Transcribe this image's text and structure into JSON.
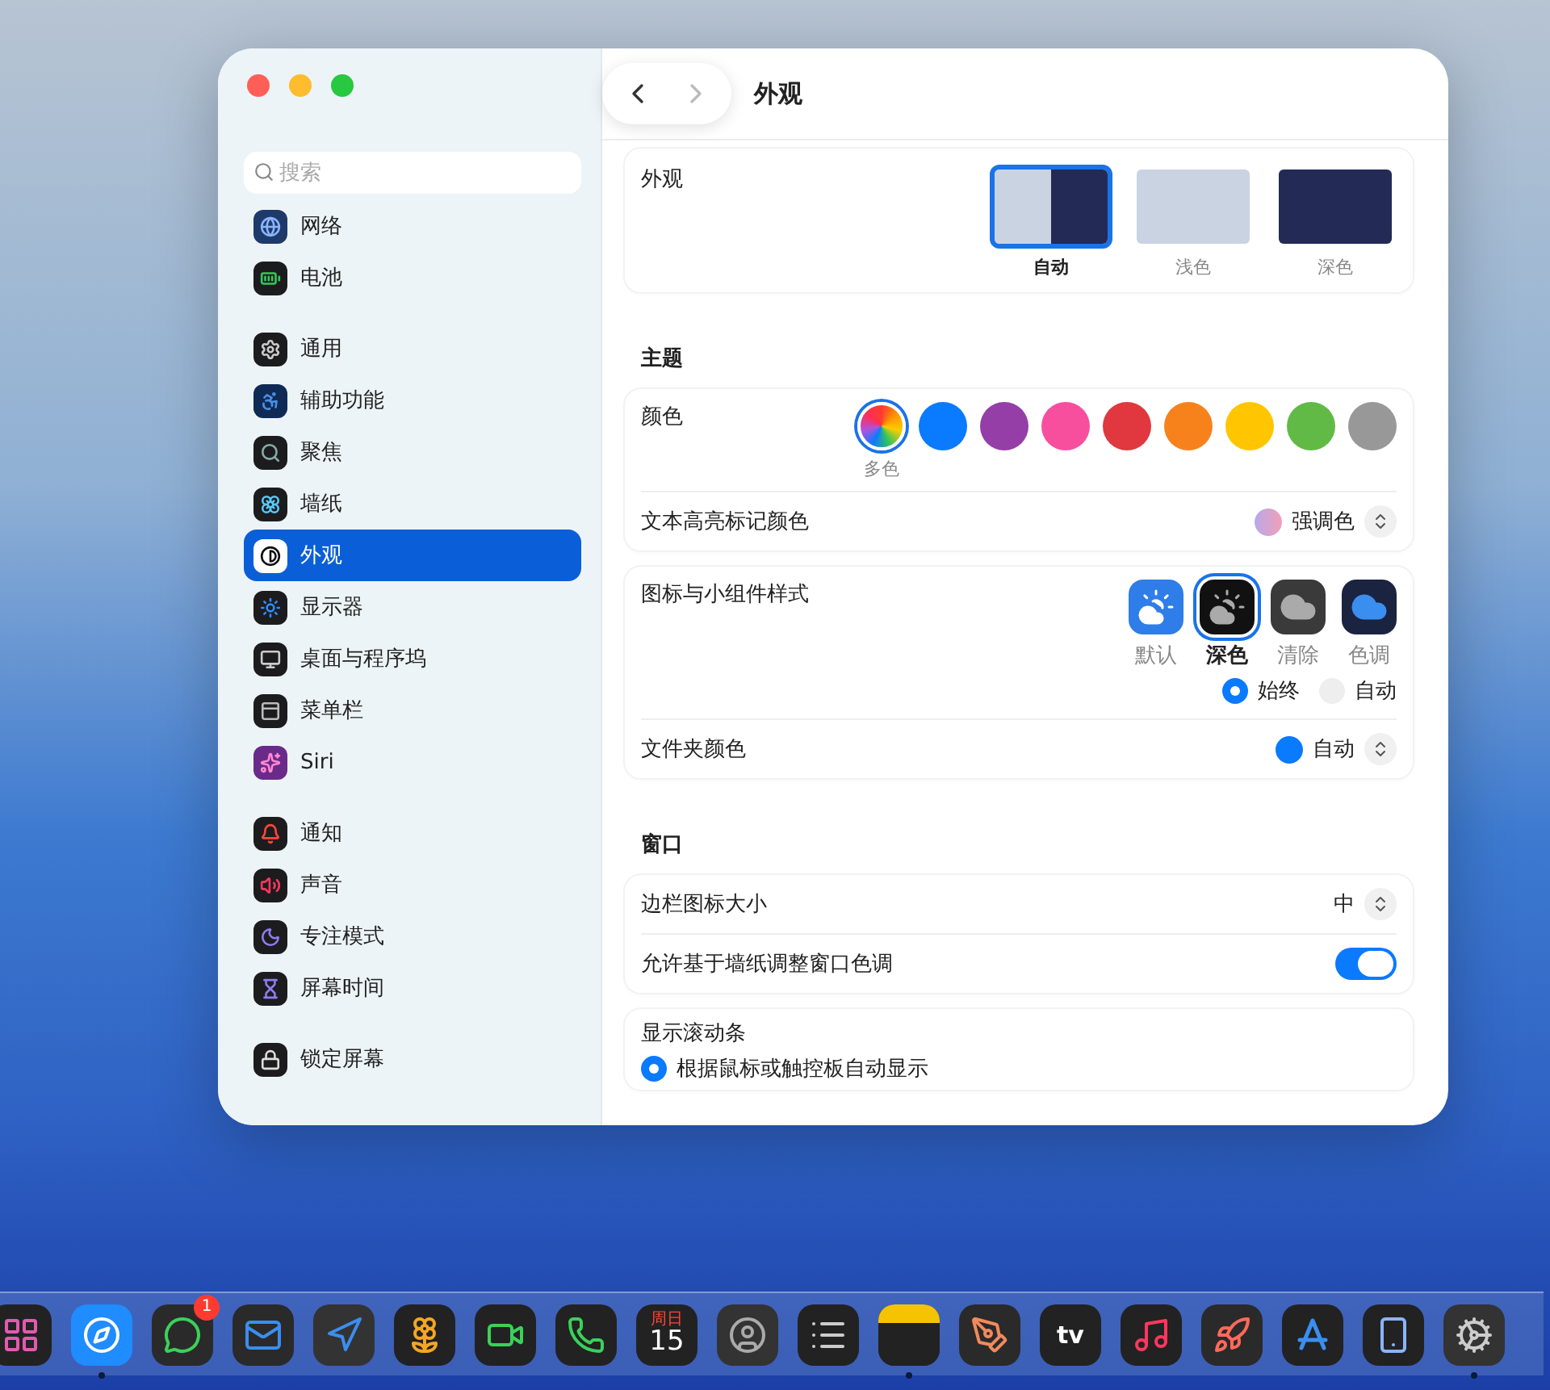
{
  "toolbar": {
    "nav": [
      {
        "kind": "back",
        "disabled": false
      },
      {
        "kind": "forward",
        "disabled": true
      }
    ],
    "title": "外观"
  },
  "sidebar": {
    "search": {
      "placeholder": "搜索"
    },
    "groups": [
      {
        "items": [
          {
            "label": "网络",
            "selected": false
          },
          {
            "label": "电池",
            "selected": false
          }
        ]
      },
      {
        "items": [
          {
            "label": "通用",
            "selected": false
          },
          {
            "label": "辅助功能",
            "selected": false
          },
          {
            "label": "聚焦",
            "selected": false
          },
          {
            "label": "墙纸",
            "selected": false
          },
          {
            "label": "外观",
            "selected": true
          },
          {
            "label": "显示器",
            "selected": false
          },
          {
            "label": "桌面与程序坞",
            "selected": false
          },
          {
            "label": "菜单栏",
            "selected": false
          },
          {
            "label": "Siri",
            "selected": false
          }
        ]
      },
      {
        "items": [
          {
            "label": "通知",
            "selected": false
          },
          {
            "label": "声音",
            "selected": false
          },
          {
            "label": "专注模式",
            "selected": false
          },
          {
            "label": "屏幕时间",
            "selected": false
          }
        ]
      },
      {
        "items": [
          {
            "label": "锁定屏幕",
            "selected": false
          }
        ]
      }
    ]
  },
  "appearance": {
    "label": "外观",
    "options": [
      {
        "kind": "auto",
        "label": "自动",
        "selected": true
      },
      {
        "kind": "light",
        "label": "浅色",
        "selected": false
      },
      {
        "kind": "dark",
        "label": "深色",
        "selected": false
      }
    ]
  },
  "theme": {
    "heading": "主题",
    "color_label": "颜色",
    "swatches": [
      {
        "kind": "multicolor",
        "label": "多色",
        "selected": true
      },
      {
        "kind": "solid",
        "color": "#0a7aff",
        "selected": false
      },
      {
        "kind": "solid",
        "color": "#953ea8",
        "selected": false
      },
      {
        "kind": "solid",
        "color": "#f74f9e",
        "selected": false
      },
      {
        "kind": "solid",
        "color": "#e0383e",
        "selected": false
      },
      {
        "kind": "solid",
        "color": "#f7821b",
        "selected": false
      },
      {
        "kind": "solid",
        "color": "#ffc600",
        "selected": false
      },
      {
        "kind": "solid",
        "color": "#62ba46",
        "selected": false
      },
      {
        "kind": "solid",
        "color": "#989898",
        "selected": false
      }
    ],
    "highlight": {
      "label": "文本高亮标记颜色",
      "value": "强调色"
    }
  },
  "icon_style": {
    "label": "图标与小组件样式",
    "options": [
      {
        "kind": "default",
        "label": "默认",
        "selected": false
      },
      {
        "kind": "dark",
        "label": "深色",
        "selected": true
      },
      {
        "kind": "clear",
        "label": "清除",
        "selected": false
      },
      {
        "kind": "tinted",
        "label": "色调",
        "selected": false
      }
    ],
    "modes": [
      {
        "label": "始终",
        "selected": true
      },
      {
        "label": "自动",
        "selected": false
      }
    ],
    "folder": {
      "label": "文件夹颜色",
      "value": "自动"
    }
  },
  "window_section": {
    "heading": "窗口",
    "sidebar_size": {
      "label": "边栏图标大小",
      "value": "中"
    },
    "wallpaper_tint": {
      "label": "允许基于墙纸调整窗口色调",
      "on": true
    },
    "scrollbars": {
      "label": "显示滚动条",
      "options": [
        {
          "label": "根据鼠标或触控板自动显示",
          "selected": true
        }
      ]
    }
  },
  "dock": {
    "items": [
      {
        "kind": "launchpad",
        "running": false
      },
      {
        "kind": "safari",
        "running": true
      },
      {
        "kind": "messages",
        "running": false,
        "badge": "1"
      },
      {
        "kind": "mail",
        "running": false
      },
      {
        "kind": "maps",
        "running": false
      },
      {
        "kind": "photos",
        "running": false
      },
      {
        "kind": "facetime",
        "running": false
      },
      {
        "kind": "phone",
        "running": false
      },
      {
        "kind": "calendar",
        "running": false,
        "weekday": "周日",
        "date": "15"
      },
      {
        "kind": "contacts",
        "running": false
      },
      {
        "kind": "reminders",
        "running": false
      },
      {
        "kind": "notes",
        "running": true
      },
      {
        "kind": "freeform",
        "running": false
      },
      {
        "kind": "tv",
        "running": false,
        "label": "tv"
      },
      {
        "kind": "music",
        "running": false
      },
      {
        "kind": "rocket",
        "running": false
      },
      {
        "kind": "appstore",
        "running": false
      },
      {
        "kind": "mirroring",
        "running": false
      },
      {
        "kind": "settings",
        "running": true
      }
    ]
  }
}
